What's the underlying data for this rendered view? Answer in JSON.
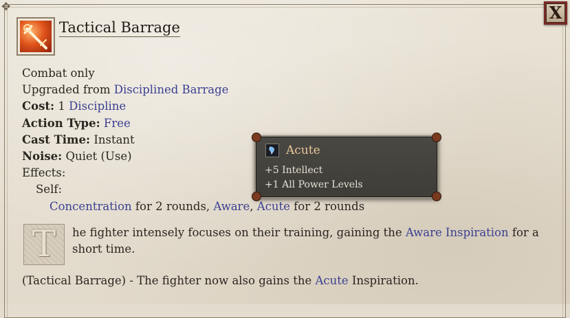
{
  "ability": {
    "title": "Tactical Barrage",
    "icon": "tactical-barrage-icon",
    "combat_only": "Combat only",
    "upgraded_prefix": "Upgraded from ",
    "upgraded_from": "Disciplined Barrage",
    "cost_label": "Cost:",
    "cost_value": "1",
    "cost_resource": "Discipline",
    "action_type_label": "Action Type:",
    "action_type_value": "Free",
    "cast_time_label": "Cast Time:",
    "cast_time_value": "Instant",
    "noise_label": "Noise:",
    "noise_value": "Quiet (Use)",
    "effects_label": "Effects:",
    "self_label": "Self:",
    "effect_concentration": "Concentration",
    "effect_concentration_dur": " for 2 rounds, ",
    "effect_aware": "Aware",
    "effect_sep": ", ",
    "effect_acute": "Acute",
    "effect_acute_dur": " for 2 rounds",
    "dropcap_letter": "T",
    "desc_pre": "he fighter intensely focuses on their training, gaining the ",
    "desc_link": "Aware Inspiration",
    "desc_post": " for a short time.",
    "extra_pre": "(Tactical Barrage) - The fighter now also gains the ",
    "extra_link": "Acute",
    "extra_post": " Inspiration."
  },
  "close_button": {
    "label": "X",
    "icon": "close-icon"
  },
  "tooltip": {
    "title": "Acute",
    "icon": "acute-inspiration-icon",
    "line1": "+5 Intellect",
    "line2": "+1 All Power Levels"
  },
  "colors": {
    "link": "#3a3f91",
    "tooltip_title": "#e8c89a",
    "close_border": "#7a2a25"
  }
}
